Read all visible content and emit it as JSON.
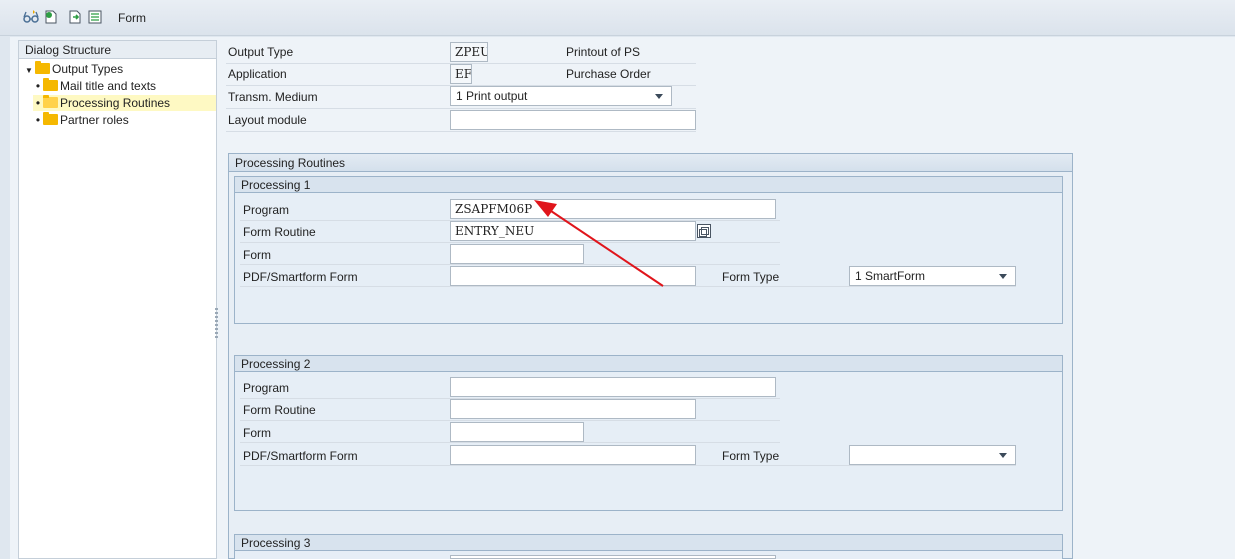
{
  "toolbar": {
    "icons": [
      "glasses-icon",
      "new-entries-icon",
      "copy-as-icon",
      "delete-icon"
    ],
    "title": "Form"
  },
  "left": {
    "header": "Dialog Structure",
    "items": [
      {
        "label": "Output Types",
        "icon": "folder-icon"
      },
      {
        "label": "Mail title and texts",
        "icon": "folder-icon"
      },
      {
        "label": "Processing Routines",
        "icon": "folder-open-icon",
        "selected": true
      },
      {
        "label": "Partner roles",
        "icon": "folder-icon"
      }
    ]
  },
  "header": {
    "output_type_label": "Output Type",
    "output_type_value": "ZPEU",
    "output_type_desc": "Printout of PS",
    "application_label": "Application",
    "application_value": "EF",
    "application_desc": "Purchase Order",
    "medium_label": "Transm. Medium",
    "medium_value": "1 Print output",
    "layout_label": "Layout module",
    "layout_value": ""
  },
  "routines": {
    "title": "Processing Routines",
    "p1": {
      "title": "Processing 1",
      "program_label": "Program",
      "program_value": "ZSAPFM06P",
      "routine_label": "Form Routine",
      "routine_value": "ENTRY_NEU",
      "form_label": "Form",
      "form_value": "",
      "pdf_label": "PDF/Smartform Form",
      "pdf_value": "",
      "formtype_label": "Form Type",
      "formtype_value": "1 SmartForm"
    },
    "p2": {
      "title": "Processing 2",
      "program_label": "Program",
      "routine_label": "Form Routine",
      "form_label": "Form",
      "pdf_label": "PDF/Smartform Form",
      "formtype_label": "Form Type",
      "formtype_value": ""
    },
    "p3": {
      "title": "Processing 3"
    }
  },
  "colors": {
    "accent_arrow": "#e0151b",
    "selected_bg": "#fef9c3"
  }
}
